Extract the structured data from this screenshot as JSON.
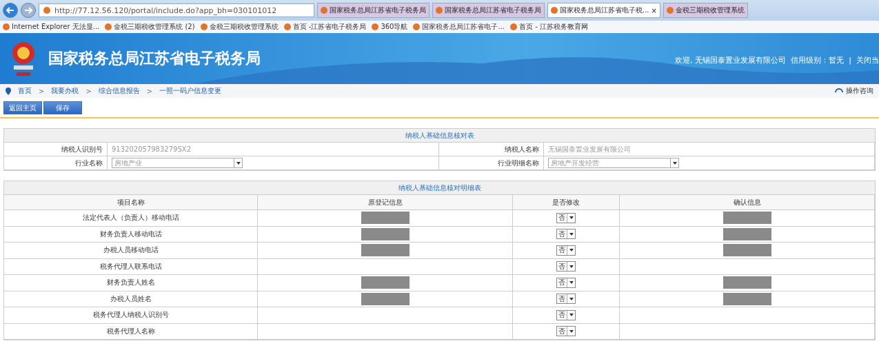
{
  "browser": {
    "url": "http://77.12.56.120/portal/include.do?app_bh=030101012",
    "tabs": [
      {
        "label": "国家税务总局江苏省电子税务局",
        "selected": false
      },
      {
        "label": "国家税务总局江苏省电子税务局",
        "selected": false
      },
      {
        "label": "国家税务总局江苏省电子税...",
        "selected": true,
        "close": "×"
      },
      {
        "label": "金税三期税收管理系统",
        "selected": false
      }
    ],
    "bookmarks": [
      "Internet Explorer 无法显...",
      "金税三期税收管理系统 (2)",
      "金税三期税收管理系统",
      "首页 -江苏省电子税务局",
      "360导航",
      "国家税务总局江苏省电子...",
      "首页 - 江苏税务教育网"
    ]
  },
  "header": {
    "title": "国家税务总局江苏省电子税务局",
    "user_info": "欢迎, 无锡国泰置业发展有限公司  信用级别：暂无  |  关闭当"
  },
  "breadcrumb": [
    "首页",
    "我要办税",
    "综合信息报告",
    "一照一码户信息变更"
  ],
  "breadcrumb_separator": ">",
  "help_link": "操作咨询",
  "buttons": [
    "返回主页",
    "保存"
  ],
  "check_table": {
    "title": "纳税人基础信息核对表",
    "rows": [
      [
        {
          "label": "纳税人识别号",
          "value": "913202057983279SX2",
          "kind": "text"
        },
        {
          "label": "纳税人名称",
          "value": "无锡国泰置业发展有限公司",
          "kind": "text"
        }
      ],
      [
        {
          "label": "行业名称",
          "value": "房地产业",
          "kind": "select"
        },
        {
          "label": "行业明细名称",
          "value": "房地产开发经营",
          "kind": "select"
        }
      ]
    ]
  },
  "detail_table": {
    "title": "纳税人基础信息核对明细表",
    "columns": [
      "项目名称",
      "原登记信息",
      "是否修改",
      "确认信息"
    ],
    "rows": [
      {
        "name": "法定代表人（负责人）移动电话",
        "original_redacted": true,
        "modify": "否",
        "confirm_redacted": true
      },
      {
        "name": "财务负责人移动电话",
        "original_redacted": true,
        "modify": "否",
        "confirm_redacted": true
      },
      {
        "name": "办税人员移动电话",
        "original_redacted": true,
        "modify": "否",
        "confirm_redacted": true
      },
      {
        "name": "税务代理人联系电话",
        "original_redacted": false,
        "modify": "否",
        "confirm_redacted": false
      },
      {
        "name": "财务负责人姓名",
        "original_redacted": true,
        "modify": "否",
        "confirm_redacted": true
      },
      {
        "name": "办税人员姓名",
        "original_redacted": true,
        "modify": "否",
        "confirm_redacted": true
      },
      {
        "name": "税务代理人纳税人识别号",
        "original_redacted": false,
        "modify": "否",
        "confirm_redacted": false
      },
      {
        "name": "税务代理人名称",
        "original_redacted": false,
        "modify": "否",
        "confirm_redacted": false
      }
    ]
  }
}
